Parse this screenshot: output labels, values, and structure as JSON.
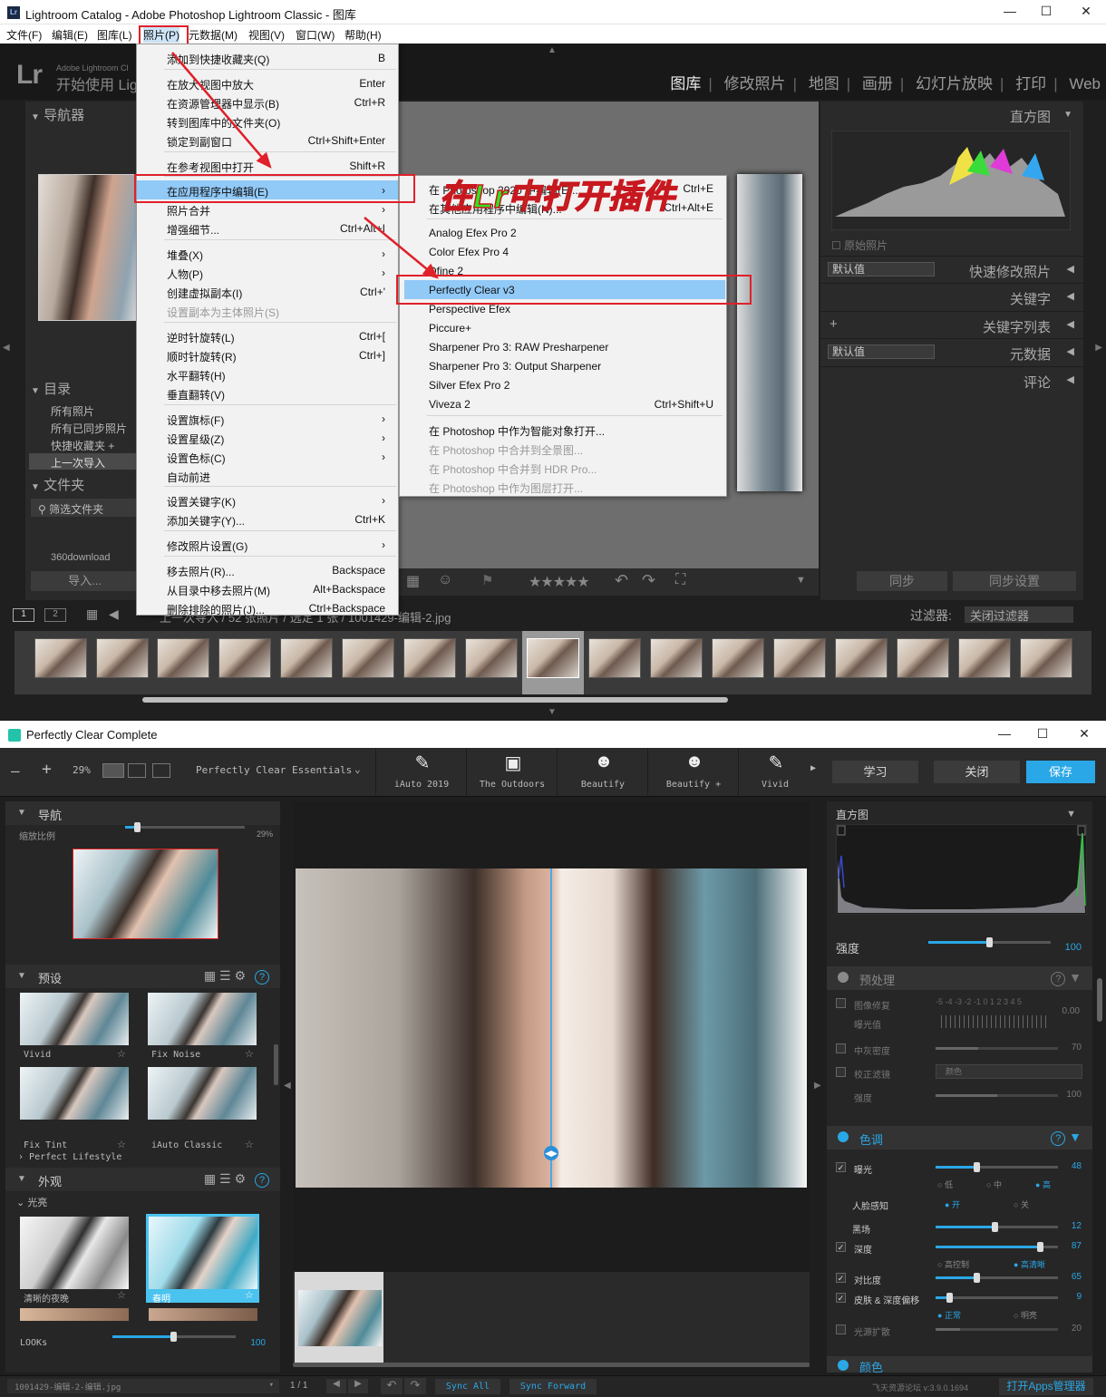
{
  "lr": {
    "window_title": "Lightroom Catalog - Adobe Photoshop Lightroom Classic - 图库",
    "menubar": [
      "文件(F)",
      "编辑(E)",
      "图库(L)",
      "照片(P)",
      "元数据(M)",
      "视图(V)",
      "窗口(W)",
      "帮助(H)"
    ],
    "identity": {
      "small": "Adobe Lightroom Cl",
      "big": "开始使用 Lig"
    },
    "modules": [
      "图库",
      "修改照片",
      "地图",
      "画册",
      "幻灯片放映",
      "打印",
      "Web"
    ],
    "left_panel": {
      "navigator": "导航器",
      "catalog": "目录",
      "catalog_items": [
        "所有照片",
        "所有已同步照片",
        "快捷收藏夹 +",
        "上一次导入"
      ],
      "folders": "文件夹",
      "filter_folders": "筛选文件夹",
      "folder_row": "360download",
      "import_button": "导入..."
    },
    "right_panel": {
      "histogram": "直方图",
      "original_photo": "原始照片",
      "preset_default": "默认值",
      "quick_develop": "快速修改照片",
      "keywords": "关键字",
      "keyword_list": "关键字列表",
      "metadata_default": "默认值",
      "metadata": "元数据",
      "comments": "评论",
      "sync": "同步",
      "sync_settings": "同步设置"
    },
    "filmbar": {
      "pages": [
        "1",
        "2"
      ],
      "path": "上一次导入 / 52 张照片 / 选定 1 张 / 1001429-编辑-2.jpg",
      "filter_label": "过滤器:",
      "filter_value": "关闭过滤器"
    },
    "menu_photo": [
      {
        "label": "添加到快捷收藏夹(Q)",
        "shortcut": "B"
      },
      {
        "label": "在放大视图中放大",
        "shortcut": "Enter"
      },
      {
        "label": "在资源管理器中显示(B)",
        "shortcut": "Ctrl+R"
      },
      {
        "label": "转到图库中的文件夹(O)",
        "shortcut": ""
      },
      {
        "label": "锁定到副窗口",
        "shortcut": "Ctrl+Shift+Enter"
      },
      {
        "label": "在参考视图中打开",
        "shortcut": "Shift+R"
      },
      {
        "label": "在应用程序中编辑(E)",
        "shortcut": "›"
      },
      {
        "label": "照片合并",
        "shortcut": "›"
      },
      {
        "label": "增强细节...",
        "shortcut": "Ctrl+Alt+I"
      },
      {
        "label": "堆叠(X)",
        "shortcut": "›"
      },
      {
        "label": "人物(P)",
        "shortcut": "›"
      },
      {
        "label": "创建虚拟副本(I)",
        "shortcut": "Ctrl+'"
      },
      {
        "label": "设置副本为主体照片(S)",
        "shortcut": ""
      },
      {
        "label": "逆时针旋转(L)",
        "shortcut": "Ctrl+["
      },
      {
        "label": "顺时针旋转(R)",
        "shortcut": "Ctrl+]"
      },
      {
        "label": "水平翻转(H)",
        "shortcut": ""
      },
      {
        "label": "垂直翻转(V)",
        "shortcut": ""
      },
      {
        "label": "设置旗标(F)",
        "shortcut": "›"
      },
      {
        "label": "设置星级(Z)",
        "shortcut": "›"
      },
      {
        "label": "设置色标(C)",
        "shortcut": "›"
      },
      {
        "label": "自动前进",
        "shortcut": ""
      },
      {
        "label": "设置关键字(K)",
        "shortcut": "›"
      },
      {
        "label": "添加关键字(Y)...",
        "shortcut": "Ctrl+K"
      },
      {
        "label": "修改照片设置(G)",
        "shortcut": "›"
      },
      {
        "label": "移去照片(R)...",
        "shortcut": "Backspace"
      },
      {
        "label": "从目录中移去照片(M)",
        "shortcut": "Alt+Backspace"
      },
      {
        "label": "删除排除的照片(J)...",
        "shortcut": "Ctrl+Backspace"
      }
    ],
    "menu_edit_in": [
      {
        "label": "在 Photoshop 2020 中编辑(E)...",
        "shortcut": "Ctrl+E"
      },
      {
        "label": "在其他应用程序中编辑(N)...",
        "shortcut": "Ctrl+Alt+E"
      },
      {
        "label": "Analog Efex Pro 2",
        "shortcut": ""
      },
      {
        "label": "Color Efex Pro 4",
        "shortcut": ""
      },
      {
        "label": "Dfine 2",
        "shortcut": ""
      },
      {
        "label": "Perfectly Clear v3",
        "shortcut": ""
      },
      {
        "label": "Perspective Efex",
        "shortcut": ""
      },
      {
        "label": "Piccure+",
        "shortcut": ""
      },
      {
        "label": "Sharpener Pro 3: RAW Presharpener",
        "shortcut": ""
      },
      {
        "label": "Sharpener Pro 3: Output Sharpener",
        "shortcut": ""
      },
      {
        "label": "Silver Efex Pro 2",
        "shortcut": ""
      },
      {
        "label": "Viveza 2",
        "shortcut": "Ctrl+Shift+U"
      },
      {
        "label": "在 Photoshop 中作为智能对象打开...",
        "shortcut": ""
      },
      {
        "label": "在 Photoshop 中合并到全景图...",
        "shortcut": ""
      },
      {
        "label": "在 Photoshop 中合并到 HDR Pro...",
        "shortcut": ""
      },
      {
        "label": "在 Photoshop 中作为图层打开...",
        "shortcut": ""
      }
    ],
    "annotation": "在Lr中打开插件"
  },
  "pc": {
    "window_title": "Perfectly Clear Complete",
    "zoom": "29%",
    "preset_group": "Perfectly Clear Essentials",
    "presets": [
      {
        "label": "iAuto 2019",
        "icon": "pen-2019-icon"
      },
      {
        "label": "The Outdoors",
        "icon": "landscape-icon"
      },
      {
        "label": "Beautify",
        "icon": "face-icon"
      },
      {
        "label": "Beautify +",
        "icon": "face-plus-icon"
      },
      {
        "label": "Vivid",
        "icon": "brush-icon"
      }
    ],
    "buttons": {
      "learn": "学习",
      "close": "关闭",
      "save": "保存"
    },
    "navigator": {
      "title": "导航",
      "zoom_label": "缩放比例",
      "zoom_value": "29%"
    },
    "presets_panel": {
      "title": "预设",
      "items": [
        "Vivid",
        "Fix Noise",
        "Fix Tint",
        "iAuto Classic"
      ],
      "group": "Perfect Lifestyle"
    },
    "looks_panel": {
      "title": "外观",
      "group": "光亮",
      "items": [
        "清晰的夜晚",
        "春明"
      ],
      "looks_label": "LOOKs",
      "looks_value": "100"
    },
    "histogram": "直方图",
    "strength": {
      "label": "强度",
      "value": "100"
    },
    "preprocess": {
      "title": "预处理",
      "image_repair": "图像修复",
      "exposure_value": "曝光值",
      "scale": "-5 -4 -3 -2 -1 0 1 2 3 4 5",
      "exposure_num": "0.00",
      "midtones": "中灰密度",
      "midtones_value": "70",
      "correct_filter": "校正滤镜",
      "filter_select": "颜色",
      "strength": "强度",
      "strength_value": "100"
    },
    "tone": {
      "title": "色调",
      "exposure": "曝光",
      "exposure_value": "48",
      "exposure_opts": [
        "低",
        "中",
        "高"
      ],
      "face_aware": "人脸感知",
      "face_opts": [
        "开",
        "关"
      ],
      "black": "黑场",
      "black_value": "12",
      "depth": "深度",
      "depth_value": "87",
      "depth_opts": [
        "高控制",
        "高清晰"
      ],
      "contrast": "对比度",
      "contrast_value": "65",
      "skin_depth": "皮肤 & 深度偏移",
      "skin_value": "9",
      "skin_opts": [
        "正常",
        "明亮"
      ],
      "light_diffusion": "光源扩散",
      "light_value": "20",
      "next_section": "颜色"
    },
    "status": {
      "filename": "1001429-编辑-2-编辑.jpg",
      "page": "1 / 1",
      "sync_all": "Sync All",
      "sync_forward": "Sync Forward",
      "version": "飞天资源论坛 v:3.9.0.1694",
      "apps_manager": "打开Apps管理器"
    }
  }
}
